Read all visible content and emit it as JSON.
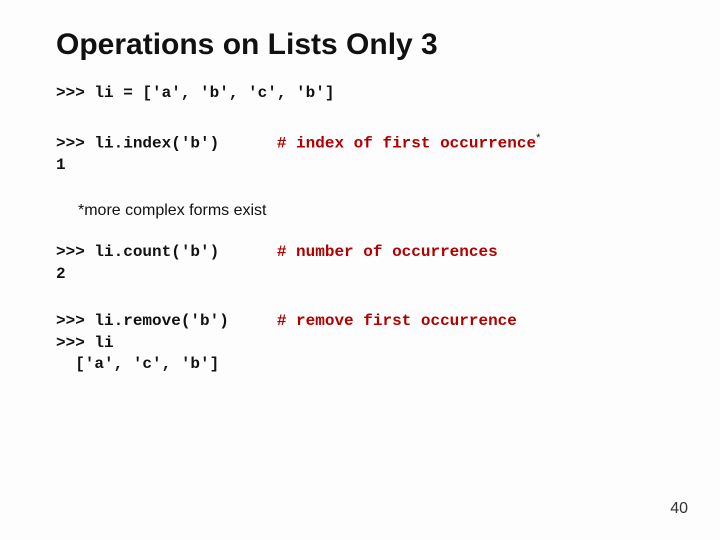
{
  "title": "Operations on Lists Only 3",
  "block1": {
    "line1": ">>> li = ['a', 'b', 'c', 'b']"
  },
  "block2": {
    "line1a": ">>> li.index('b')",
    "line1b": "      # ",
    "line1c": "index of first occurrence",
    "line2": "1"
  },
  "note": "*more complex forms exist",
  "block3": {
    "line1a": ">>> li.count('b')",
    "line1b": "      # ",
    "line1c": "number of occurrences",
    "line2": "2"
  },
  "block4": {
    "line1a": ">>> li.remove('b')",
    "line1b": "     # ",
    "line1c": "remove first occurrence",
    "line2": ">>> li",
    "line3": "  ['a', 'c', 'b']"
  },
  "pagenum": "40"
}
